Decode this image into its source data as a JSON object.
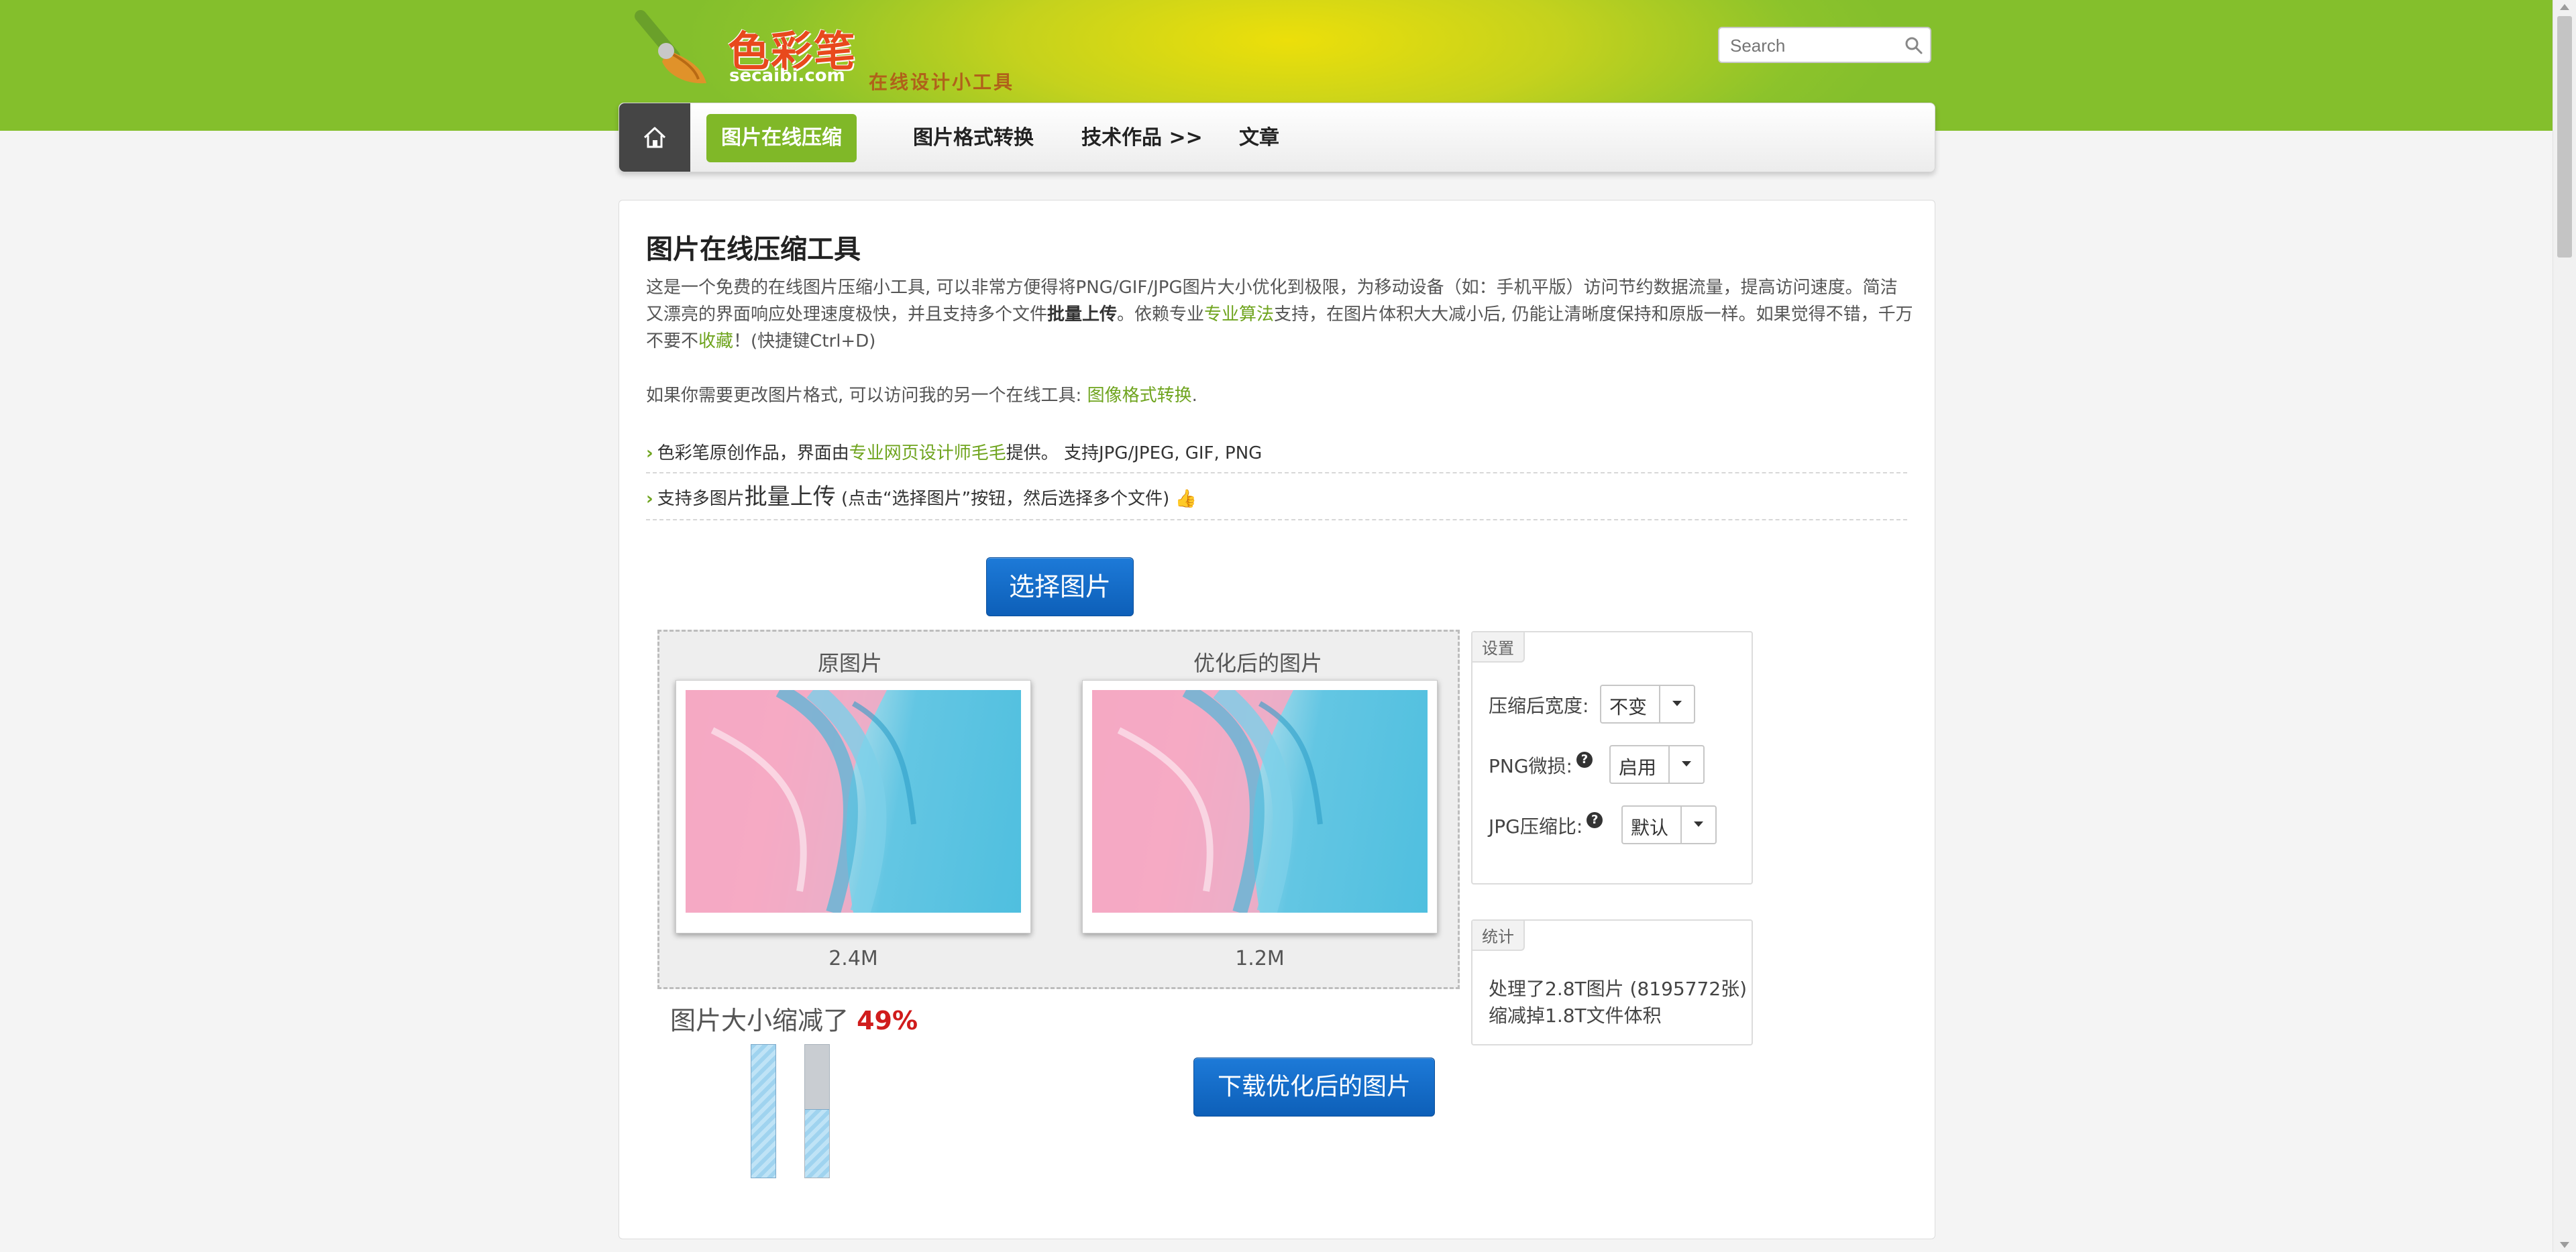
{
  "logo": {
    "title": "色彩笔",
    "domain": "secaibi.com",
    "slogan": "在线设计小工具"
  },
  "search": {
    "placeholder": "Search"
  },
  "nav": {
    "items": [
      {
        "label": "图片在线压缩"
      },
      {
        "label": "图片格式转换"
      },
      {
        "label": "技术作品 >>"
      },
      {
        "label": "文章"
      }
    ]
  },
  "main": {
    "title": "图片在线压缩工具",
    "intro": {
      "t1": "这是一个免费的在线图片压缩小工具, 可以非常方便得将PNG/GIF/JPG图片大小优化到极限，为移动设备（如：手机平版）访问节约数据流量，提高访问速度。简洁又漂亮的界面响应处理速度极快，并且支持多个文件",
      "b1": "批量上传",
      "t2": "。依赖专业",
      "link1": "专业算法",
      "t3": "支持，在图片体积大大减小后, 仍能让清晰度保持和原版一样。如果觉得不错，千万不要不",
      "link2": "收藏",
      "t4": "！(快捷键Ctrl+D)"
    },
    "p2": {
      "text": "如果你需要更改图片格式, 可以访问我的另一个在线工具: ",
      "link": "图像格式转换",
      "end": "."
    },
    "feature1": {
      "t1": "色彩笔原创作品，界面由",
      "link": "专业网页设计师毛毛",
      "t2": "提供。 支持JPG/JPEG, GIF, PNG"
    },
    "feature2": {
      "t1": "支持多图片",
      "big": "批量上传",
      "t2": " (点击“选择图片”按钮，然后选择多个文件)"
    },
    "select_button": "选择图片",
    "original_caption": "原图片",
    "optimized_caption": "优化后的图片",
    "original_size": "2.4M",
    "optimized_size": "1.2M",
    "reduce_text": "图片大小缩减了 ",
    "reduce_pct": "49%",
    "reduce_fraction": 0.49,
    "download_button": "下载优化后的图片"
  },
  "settings": {
    "tag": "设置",
    "width_label": "压缩后宽度:",
    "width_value": "不变",
    "png_label": "PNG微损:",
    "png_value": "启用",
    "jpg_label": "JPG压缩比:",
    "jpg_value": "默认"
  },
  "stats": {
    "tag": "统计",
    "line1": "处理了2.8T图片 (8195772张)",
    "line2": "缩减掉1.8T文件体积"
  },
  "colors": {
    "accent": "#80b828",
    "link": "#6fa41e",
    "button": "#0d5fb8",
    "percent": "#d01c1c"
  }
}
